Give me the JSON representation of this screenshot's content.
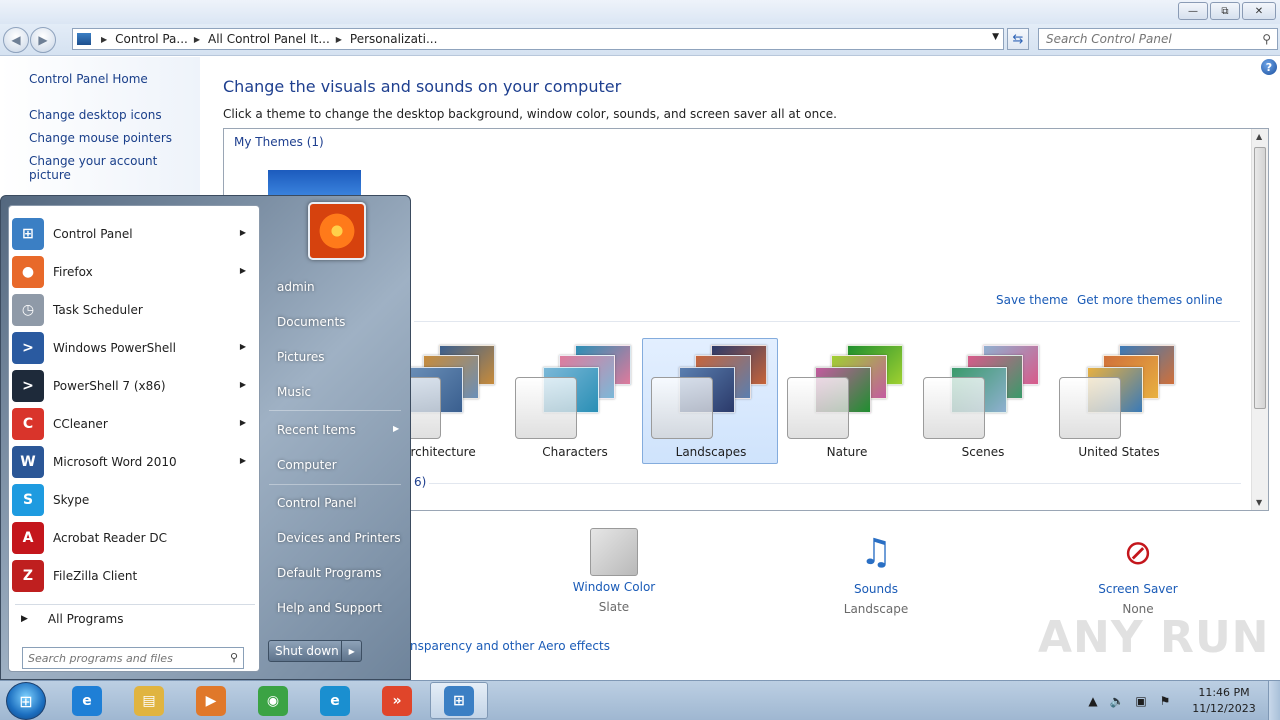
{
  "window": {
    "minimize_glyph": "—",
    "maximize_glyph": "⧉",
    "close_glyph": "✕"
  },
  "address": {
    "crumbs": [
      "Control Pa...",
      "All Control Panel It...",
      "Personalizati..."
    ],
    "search_placeholder": "Search Control Panel"
  },
  "left_pane": {
    "home": "Control Panel Home",
    "links": [
      "Change desktop icons",
      "Change mouse pointers",
      "Change your account picture"
    ]
  },
  "main": {
    "title": "Change the visuals and sounds on your computer",
    "subtitle": "Click a theme to change the desktop background, window color, sounds, and screen saver all at once.",
    "my_themes_label": "My Themes (1)",
    "save_theme": "Save theme",
    "get_more_themes": "Get more themes online",
    "aero_group_partial": "6)",
    "themes": [
      {
        "name": "Architecture",
        "selected": false,
        "colors": [
          "#3a5f8f",
          "#c88b3a",
          "#6a8fb8"
        ]
      },
      {
        "name": "Characters",
        "selected": false,
        "colors": [
          "#2a8fb5",
          "#e07a9c",
          "#7bb8d8"
        ]
      },
      {
        "name": "Landscapes",
        "selected": true,
        "colors": [
          "#2b3a6a",
          "#c7643a",
          "#5a7fb0"
        ]
      },
      {
        "name": "Nature",
        "selected": false,
        "colors": [
          "#1f8f2f",
          "#9fd030",
          "#c45aa0"
        ]
      },
      {
        "name": "Scenes",
        "selected": false,
        "colors": [
          "#8fb0d0",
          "#d85a8a",
          "#3a9a6a"
        ]
      },
      {
        "name": "United States",
        "selected": false,
        "colors": [
          "#3a7ab8",
          "#d0703a",
          "#e8b040"
        ]
      }
    ],
    "bottom": {
      "window_color_label": "Window Color",
      "window_color_value": "Slate",
      "sounds_label": "Sounds",
      "sounds_value": "Landscape",
      "screensaver_label": "Screen Saver",
      "screensaver_value": "None",
      "aero_link": "nsparency and other Aero effects"
    }
  },
  "start_menu": {
    "programs": [
      {
        "label": "Control Panel",
        "icon": "control-panel-icon",
        "glyph": "⊞",
        "bg": "#3b7fc4",
        "submenu": true
      },
      {
        "label": "Firefox",
        "icon": "firefox-icon",
        "glyph": "●",
        "bg": "#e8692a",
        "submenu": true
      },
      {
        "label": "Task Scheduler",
        "icon": "clock-icon",
        "glyph": "◷",
        "bg": "#8f9aa8",
        "submenu": false
      },
      {
        "label": "Windows PowerShell",
        "icon": "powershell-icon",
        "glyph": ">",
        "bg": "#2a5aa0",
        "submenu": true
      },
      {
        "label": "PowerShell 7 (x86)",
        "icon": "powershell7-icon",
        "glyph": ">",
        "bg": "#1e2a3a",
        "submenu": true
      },
      {
        "label": "CCleaner",
        "icon": "ccleaner-icon",
        "glyph": "C",
        "bg": "#d9342b",
        "submenu": true
      },
      {
        "label": "Microsoft Word 2010",
        "icon": "word-icon",
        "glyph": "W",
        "bg": "#2b5797",
        "submenu": true
      },
      {
        "label": "Skype",
        "icon": "skype-icon",
        "glyph": "S",
        "bg": "#1e9be0",
        "submenu": false
      },
      {
        "label": "Acrobat Reader DC",
        "icon": "acrobat-icon",
        "glyph": "A",
        "bg": "#c4161c",
        "submenu": false
      },
      {
        "label": "FileZilla Client",
        "icon": "filezilla-icon",
        "glyph": "Z",
        "bg": "#bf1f1f",
        "submenu": false
      }
    ],
    "all_programs": "All Programs",
    "search_placeholder": "Search programs and files",
    "right": {
      "user": "admin",
      "documents": "Documents",
      "pictures": "Pictures",
      "music": "Music",
      "recent_items": "Recent Items",
      "computer": "Computer",
      "control_panel": "Control Panel",
      "devices_printers": "Devices and Printers",
      "default_programs": "Default Programs",
      "help_support": "Help and Support"
    },
    "shutdown": "Shut down"
  },
  "taskbar": {
    "apps": [
      {
        "name": "internet-explorer-icon",
        "glyph": "e",
        "bg": "#1e7fd6",
        "active": false
      },
      {
        "name": "file-explorer-icon",
        "glyph": "▤",
        "bg": "#e0b440",
        "active": false
      },
      {
        "name": "media-player-icon",
        "glyph": "▶",
        "bg": "#e0782a",
        "active": false
      },
      {
        "name": "chrome-icon",
        "glyph": "◉",
        "bg": "#3ba344",
        "active": false
      },
      {
        "name": "edge-icon",
        "glyph": "e",
        "bg": "#1a8fd0",
        "active": false
      },
      {
        "name": "anyrun-icon",
        "glyph": "»",
        "bg": "#e0452a",
        "active": false
      },
      {
        "name": "control-panel-icon",
        "glyph": "⊞",
        "bg": "#3b7fc4",
        "active": true
      }
    ],
    "time": "11:46 PM",
    "date": "11/12/2023"
  },
  "watermark": "ANY RUN"
}
